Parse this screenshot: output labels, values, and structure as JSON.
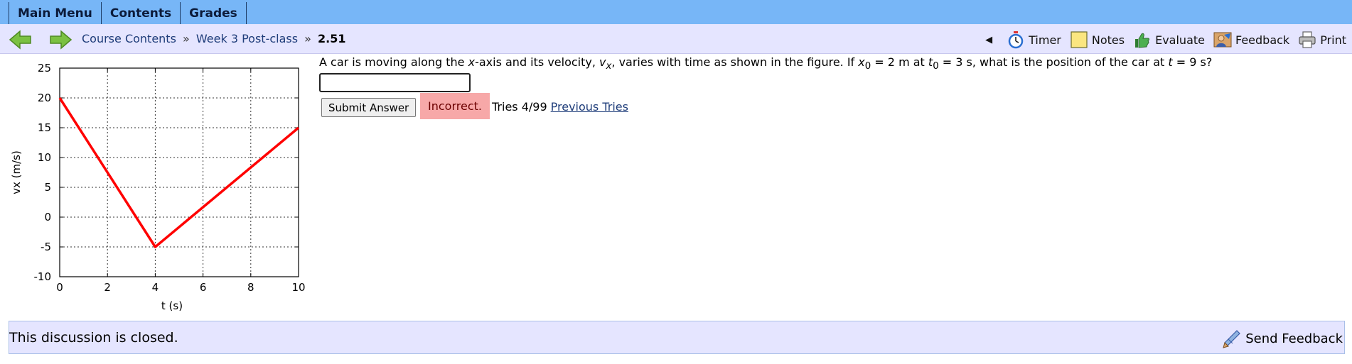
{
  "menu": {
    "tabs": [
      "Main Menu",
      "Contents",
      "Grades"
    ]
  },
  "nav": {
    "breadcrumb": [
      "Course Contents",
      "Week 3 Post-class"
    ],
    "separator": "»",
    "current": "2.51",
    "collapse_glyph": "◀",
    "tools": [
      {
        "label": "Timer",
        "icon": "stopwatch-icon"
      },
      {
        "label": "Notes",
        "icon": "notepad-icon"
      },
      {
        "label": "Evaluate",
        "icon": "thumbs-up-icon"
      },
      {
        "label": "Feedback",
        "icon": "feedback-person-icon"
      },
      {
        "label": "Print",
        "icon": "printer-icon"
      }
    ]
  },
  "question": {
    "text_1": "A car is moving along the ",
    "var_x": "x",
    "text_2": "-axis and its velocity, ",
    "var_v": "v",
    "sub_x": "x",
    "text_3": ", varies with time as shown in the figure. If ",
    "var_x0": "x",
    "sub_0a": "0",
    "text_4": " = 2 m at ",
    "var_t0": "t",
    "sub_0b": "0",
    "text_5": " = 3 s, what is the position of the car at ",
    "var_t": "t",
    "text_6": " = 9 s?",
    "answer_value": "",
    "submit_label": "Submit Answer",
    "status": "Incorrect.",
    "tries": "Tries 4/99",
    "previous_tries": "Previous Tries"
  },
  "discussion": {
    "closed_text": "This discussion is closed.",
    "send_feedback": "Send Feedback"
  },
  "colors": {
    "menubar": "#77b6f7",
    "navbar": "#e5e5ff",
    "incorrect_bg": "#f7a8a8",
    "series": "#ff0000"
  },
  "chart_data": {
    "type": "line",
    "title": "",
    "xlabel": "t (s)",
    "ylabel": "vx (m/s)",
    "xlim": [
      0,
      10
    ],
    "ylim": [
      -10,
      25
    ],
    "xticks": [
      0,
      2,
      4,
      6,
      8,
      10
    ],
    "yticks": [
      25,
      20,
      15,
      10,
      5,
      0,
      -5,
      -10
    ],
    "grid": "dotted",
    "series": [
      {
        "x": [
          0,
          4,
          10
        ],
        "y": [
          20,
          -5,
          15
        ]
      }
    ]
  }
}
